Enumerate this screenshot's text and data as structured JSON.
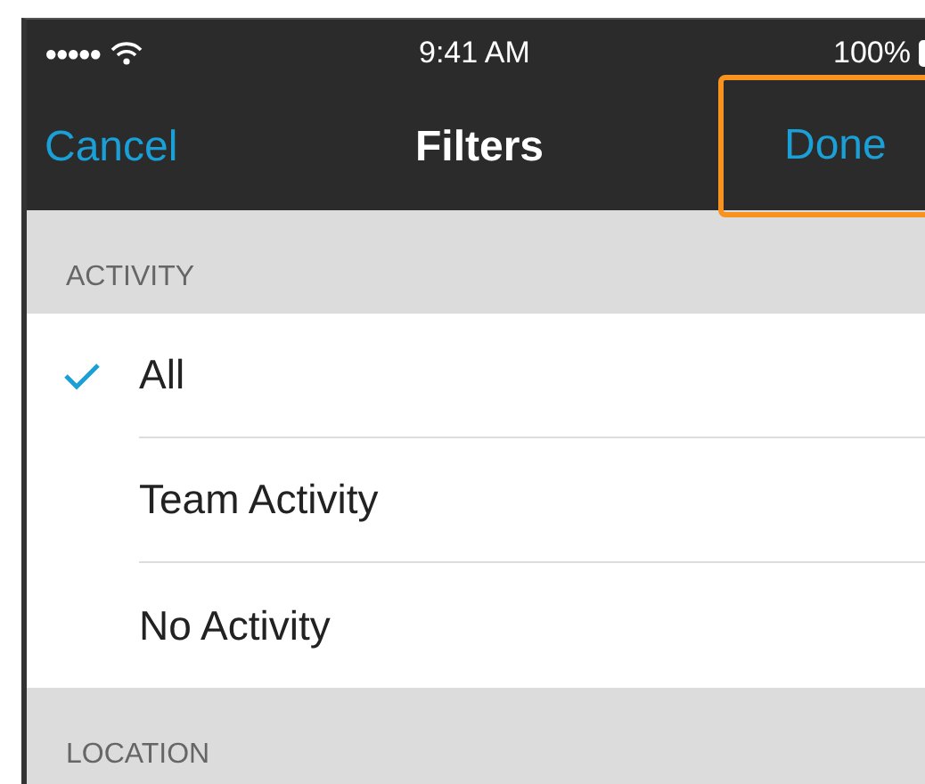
{
  "status_bar": {
    "signal_dots": "●●●●●",
    "time": "9:41 AM",
    "battery": "100%"
  },
  "nav_bar": {
    "cancel": "Cancel",
    "title": "Filters",
    "done": {
      "label": "Done",
      "highlighted": true
    }
  },
  "sections": [
    {
      "header": "ACTIVITY",
      "rows": [
        {
          "label": "All",
          "selected": true
        },
        {
          "label": "Team Activity",
          "selected": false
        },
        {
          "label": "No Activity",
          "selected": false
        }
      ]
    },
    {
      "header": "LOCATION"
    }
  ]
}
